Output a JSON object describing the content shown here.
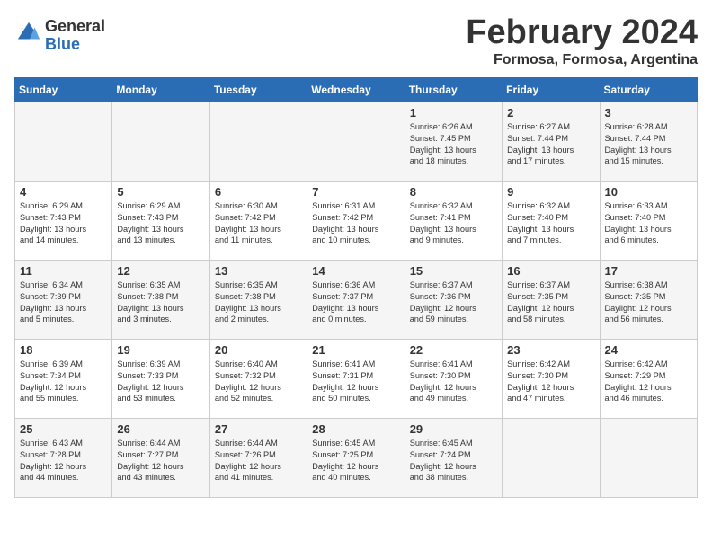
{
  "header": {
    "logo_line1": "General",
    "logo_line2": "Blue",
    "month": "February 2024",
    "location": "Formosa, Formosa, Argentina"
  },
  "days_of_week": [
    "Sunday",
    "Monday",
    "Tuesday",
    "Wednesday",
    "Thursday",
    "Friday",
    "Saturday"
  ],
  "weeks": [
    [
      {
        "day": "",
        "content": ""
      },
      {
        "day": "",
        "content": ""
      },
      {
        "day": "",
        "content": ""
      },
      {
        "day": "",
        "content": ""
      },
      {
        "day": "1",
        "content": "Sunrise: 6:26 AM\nSunset: 7:45 PM\nDaylight: 13 hours\nand 18 minutes."
      },
      {
        "day": "2",
        "content": "Sunrise: 6:27 AM\nSunset: 7:44 PM\nDaylight: 13 hours\nand 17 minutes."
      },
      {
        "day": "3",
        "content": "Sunrise: 6:28 AM\nSunset: 7:44 PM\nDaylight: 13 hours\nand 15 minutes."
      }
    ],
    [
      {
        "day": "4",
        "content": "Sunrise: 6:29 AM\nSunset: 7:43 PM\nDaylight: 13 hours\nand 14 minutes."
      },
      {
        "day": "5",
        "content": "Sunrise: 6:29 AM\nSunset: 7:43 PM\nDaylight: 13 hours\nand 13 minutes."
      },
      {
        "day": "6",
        "content": "Sunrise: 6:30 AM\nSunset: 7:42 PM\nDaylight: 13 hours\nand 11 minutes."
      },
      {
        "day": "7",
        "content": "Sunrise: 6:31 AM\nSunset: 7:42 PM\nDaylight: 13 hours\nand 10 minutes."
      },
      {
        "day": "8",
        "content": "Sunrise: 6:32 AM\nSunset: 7:41 PM\nDaylight: 13 hours\nand 9 minutes."
      },
      {
        "day": "9",
        "content": "Sunrise: 6:32 AM\nSunset: 7:40 PM\nDaylight: 13 hours\nand 7 minutes."
      },
      {
        "day": "10",
        "content": "Sunrise: 6:33 AM\nSunset: 7:40 PM\nDaylight: 13 hours\nand 6 minutes."
      }
    ],
    [
      {
        "day": "11",
        "content": "Sunrise: 6:34 AM\nSunset: 7:39 PM\nDaylight: 13 hours\nand 5 minutes."
      },
      {
        "day": "12",
        "content": "Sunrise: 6:35 AM\nSunset: 7:38 PM\nDaylight: 13 hours\nand 3 minutes."
      },
      {
        "day": "13",
        "content": "Sunrise: 6:35 AM\nSunset: 7:38 PM\nDaylight: 13 hours\nand 2 minutes."
      },
      {
        "day": "14",
        "content": "Sunrise: 6:36 AM\nSunset: 7:37 PM\nDaylight: 13 hours\nand 0 minutes."
      },
      {
        "day": "15",
        "content": "Sunrise: 6:37 AM\nSunset: 7:36 PM\nDaylight: 12 hours\nand 59 minutes."
      },
      {
        "day": "16",
        "content": "Sunrise: 6:37 AM\nSunset: 7:35 PM\nDaylight: 12 hours\nand 58 minutes."
      },
      {
        "day": "17",
        "content": "Sunrise: 6:38 AM\nSunset: 7:35 PM\nDaylight: 12 hours\nand 56 minutes."
      }
    ],
    [
      {
        "day": "18",
        "content": "Sunrise: 6:39 AM\nSunset: 7:34 PM\nDaylight: 12 hours\nand 55 minutes."
      },
      {
        "day": "19",
        "content": "Sunrise: 6:39 AM\nSunset: 7:33 PM\nDaylight: 12 hours\nand 53 minutes."
      },
      {
        "day": "20",
        "content": "Sunrise: 6:40 AM\nSunset: 7:32 PM\nDaylight: 12 hours\nand 52 minutes."
      },
      {
        "day": "21",
        "content": "Sunrise: 6:41 AM\nSunset: 7:31 PM\nDaylight: 12 hours\nand 50 minutes."
      },
      {
        "day": "22",
        "content": "Sunrise: 6:41 AM\nSunset: 7:30 PM\nDaylight: 12 hours\nand 49 minutes."
      },
      {
        "day": "23",
        "content": "Sunrise: 6:42 AM\nSunset: 7:30 PM\nDaylight: 12 hours\nand 47 minutes."
      },
      {
        "day": "24",
        "content": "Sunrise: 6:42 AM\nSunset: 7:29 PM\nDaylight: 12 hours\nand 46 minutes."
      }
    ],
    [
      {
        "day": "25",
        "content": "Sunrise: 6:43 AM\nSunset: 7:28 PM\nDaylight: 12 hours\nand 44 minutes."
      },
      {
        "day": "26",
        "content": "Sunrise: 6:44 AM\nSunset: 7:27 PM\nDaylight: 12 hours\nand 43 minutes."
      },
      {
        "day": "27",
        "content": "Sunrise: 6:44 AM\nSunset: 7:26 PM\nDaylight: 12 hours\nand 41 minutes."
      },
      {
        "day": "28",
        "content": "Sunrise: 6:45 AM\nSunset: 7:25 PM\nDaylight: 12 hours\nand 40 minutes."
      },
      {
        "day": "29",
        "content": "Sunrise: 6:45 AM\nSunset: 7:24 PM\nDaylight: 12 hours\nand 38 minutes."
      },
      {
        "day": "",
        "content": ""
      },
      {
        "day": "",
        "content": ""
      }
    ]
  ]
}
